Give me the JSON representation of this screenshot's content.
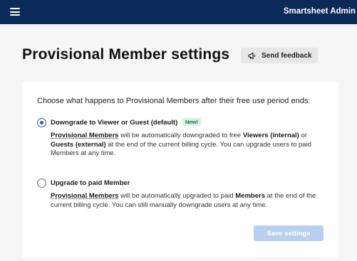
{
  "topbar": {
    "app_name": "Smartsheet Admin",
    "menu_icon": "hamburger-menu-icon"
  },
  "header": {
    "title": "Provisional Member settings",
    "feedback_label": "Send feedback",
    "feedback_icon": "megaphone-icon"
  },
  "settings": {
    "question": "Choose what happens to Provisional Members after their free use period ends:",
    "options": [
      {
        "title": "Downgrade to Viewer or Guest (default)",
        "badge": "New!",
        "selected": true,
        "desc": {
          "term": "Provisional Members",
          "part1": " will be automatically downgraded to free ",
          "term2": "Viewers (internal)",
          "part2": " or ",
          "term3": "Guests (external)",
          "part3": " at the end of the current billing cycle. You can upgrade users to paid Members at any time."
        }
      },
      {
        "title": "Upgrade to paid Member",
        "selected": false,
        "desc": {
          "term": "Provisional Members",
          "part1": " will be automatically upgraded to paid ",
          "term2": "Members",
          "part2": " at the end of the current billing cycle. You can still manually downgrade users at any time."
        }
      }
    ],
    "save_label": "Save settings"
  },
  "colors": {
    "topbar": "#0b2a59",
    "accent": "#1e5fd0",
    "badge_bg": "#d6f2e2",
    "save_disabled": "#b8cfee"
  }
}
